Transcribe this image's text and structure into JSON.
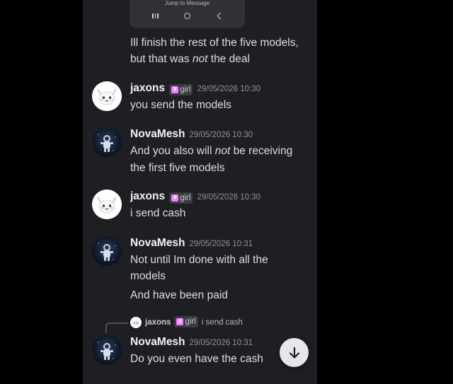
{
  "embed": {
    "jump_label": "Jump to Message"
  },
  "continued_message": {
    "line1": "Ill finish the rest of the five models,",
    "line2_before": "but that was ",
    "line2_em": "not",
    "line2_after": " the deal"
  },
  "messages": [
    {
      "username": "jaxons",
      "tag": "girl",
      "timestamp": "29/05/2026 10:30",
      "lines": [
        "you send the models"
      ]
    },
    {
      "username": "NovaMesh",
      "timestamp": "29/05/2026 10:30",
      "line1_before": "And you also will ",
      "line1_em": "not",
      "line1_after": " be receiving",
      "line2": "the first five models"
    },
    {
      "username": "jaxons",
      "tag": "girl",
      "timestamp": "29/05/2026 10:30",
      "lines": [
        "i send cash"
      ]
    },
    {
      "username": "NovaMesh",
      "timestamp": "29/05/2026 10:31",
      "lines": [
        "Not until Im done with all the",
        "models",
        "And have been paid"
      ]
    },
    {
      "username": "NovaMesh",
      "timestamp": "29/05/2026 10:31",
      "reply": {
        "username": "jaxons",
        "tag": "girl",
        "text": "i send cash"
      },
      "lines": [
        "Do you even have the cash"
      ]
    }
  ],
  "colors": {
    "background": "#1e1f22",
    "text": "#dbdee1",
    "timestamp": "#8e9297",
    "tag_icon": "#f47fff"
  },
  "icons": {
    "nav_recents": "recents-icon",
    "nav_home": "home-icon",
    "nav_back": "back-icon",
    "jump": "arrow-down-icon"
  }
}
